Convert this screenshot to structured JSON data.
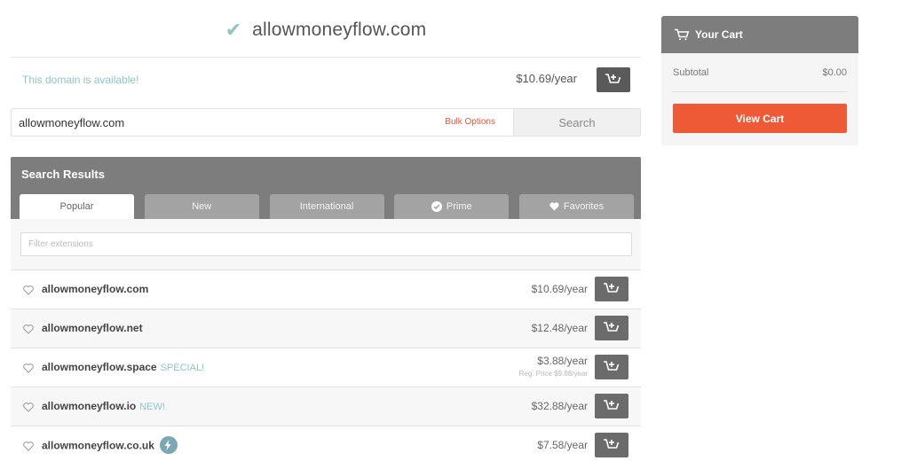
{
  "header": {
    "domain": "allowmoneyflow.com"
  },
  "availability": {
    "message": "This domain is available!",
    "price": "$10.69/year"
  },
  "search": {
    "value": "allowmoneyflow.com",
    "bulk_label": "Bulk Options",
    "button_label": "Search"
  },
  "results": {
    "title": "Search Results",
    "tabs": [
      {
        "label": "Popular",
        "icon": ""
      },
      {
        "label": "New",
        "icon": ""
      },
      {
        "label": "International",
        "icon": ""
      },
      {
        "label": "Prime",
        "icon": "check-circle-icon"
      },
      {
        "label": "Favorites",
        "icon": "heart-icon"
      }
    ],
    "filter_placeholder": "Filter extensions",
    "rows": [
      {
        "domain": "allowmoneyflow.com",
        "tag": "",
        "price": "$10.69/year",
        "reg_price": ""
      },
      {
        "domain": "allowmoneyflow.net",
        "tag": "",
        "price": "$12.48/year",
        "reg_price": ""
      },
      {
        "domain": "allowmoneyflow.space",
        "tag": "SPECIAL!",
        "price": "$3.88/year",
        "reg_price": "Reg. Price $9.88/year"
      },
      {
        "domain": "allowmoneyflow.io",
        "tag": "NEW!",
        "price": "$32.88/year",
        "reg_price": ""
      },
      {
        "domain": "allowmoneyflow.co.uk",
        "tag": "",
        "price": "$7.58/year",
        "reg_price": "",
        "badge": "lightning-icon"
      }
    ]
  },
  "cart": {
    "title": "Your Cart",
    "subtotal_label": "Subtotal",
    "subtotal_value": "$0.00",
    "view_label": "View Cart"
  },
  "colors": {
    "accent": "#ee5a36",
    "available": "#8ec5c6",
    "panel": "#7d7d7d"
  }
}
